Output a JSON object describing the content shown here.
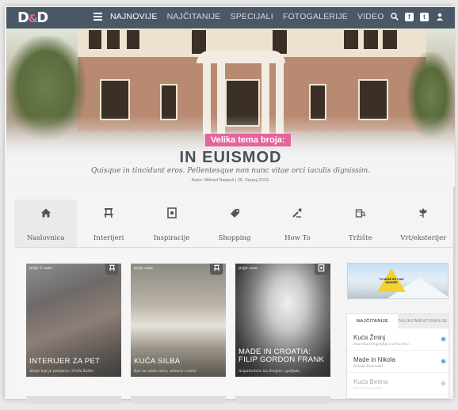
{
  "header": {
    "logo": "D&D",
    "nav": [
      "NAJNOVIJE",
      "NAJČITANIJE",
      "SPECIJALI",
      "FOTOGALERIJE",
      "VIDEO"
    ],
    "active_index": 0,
    "icons": [
      "search-icon",
      "facebook-icon",
      "twitter-icon",
      "user-icon"
    ]
  },
  "hero": {
    "badge": "Velika tema broja:",
    "title": "IN EUISMOD",
    "subtitle": "Quisque in tincidunt eros. Pellentesque non nunc vitae orci iaculis dignissim.",
    "author": "Autor: Mihovil Radauš | 26. Srpanj 2013."
  },
  "categories": [
    {
      "label": "Naslovnica",
      "icon": "home-icon"
    },
    {
      "label": "Interijeri",
      "icon": "chair-icon"
    },
    {
      "label": "Inspiracije",
      "icon": "frame-icon"
    },
    {
      "label": "Shopping",
      "icon": "tag-icon"
    },
    {
      "label": "How To",
      "icon": "tools-icon"
    },
    {
      "label": "Tržište",
      "icon": "house-search-icon"
    },
    {
      "label": "Vrt/eksterijer",
      "icon": "flower-icon"
    }
  ],
  "cards": [
    {
      "category": "prije 1 sata",
      "title": "INTERIJER ZA PET",
      "desc": "Atelje koji je podsjeća i Frida Kahlo"
    },
    {
      "category": "prije sata",
      "title": "KUĆA SILBA",
      "desc": "Kuć na otoku mira, odmora i sreće"
    },
    {
      "category": "prije sata",
      "title": "MADE IN CROATIA: FILIP GORDON FRANK",
      "desc": "Arquitectura iza dizajna i gošljata"
    }
  ],
  "ad": {
    "text": "TU MOŽE BITI VAŠ BANNER"
  },
  "sidebar": {
    "tabs": [
      "NAJČITANIJE",
      "NAJKOMENTIRANIJE"
    ],
    "items": [
      {
        "title": "Kuća Žminj",
        "sub": "Istarska fotografija u drvu fino"
      },
      {
        "title": "Made in Nikola",
        "sub": "Nikola Radovski"
      },
      {
        "title": "Kuća Betina",
        "sub": "Ova rovinj deta"
      }
    ]
  }
}
